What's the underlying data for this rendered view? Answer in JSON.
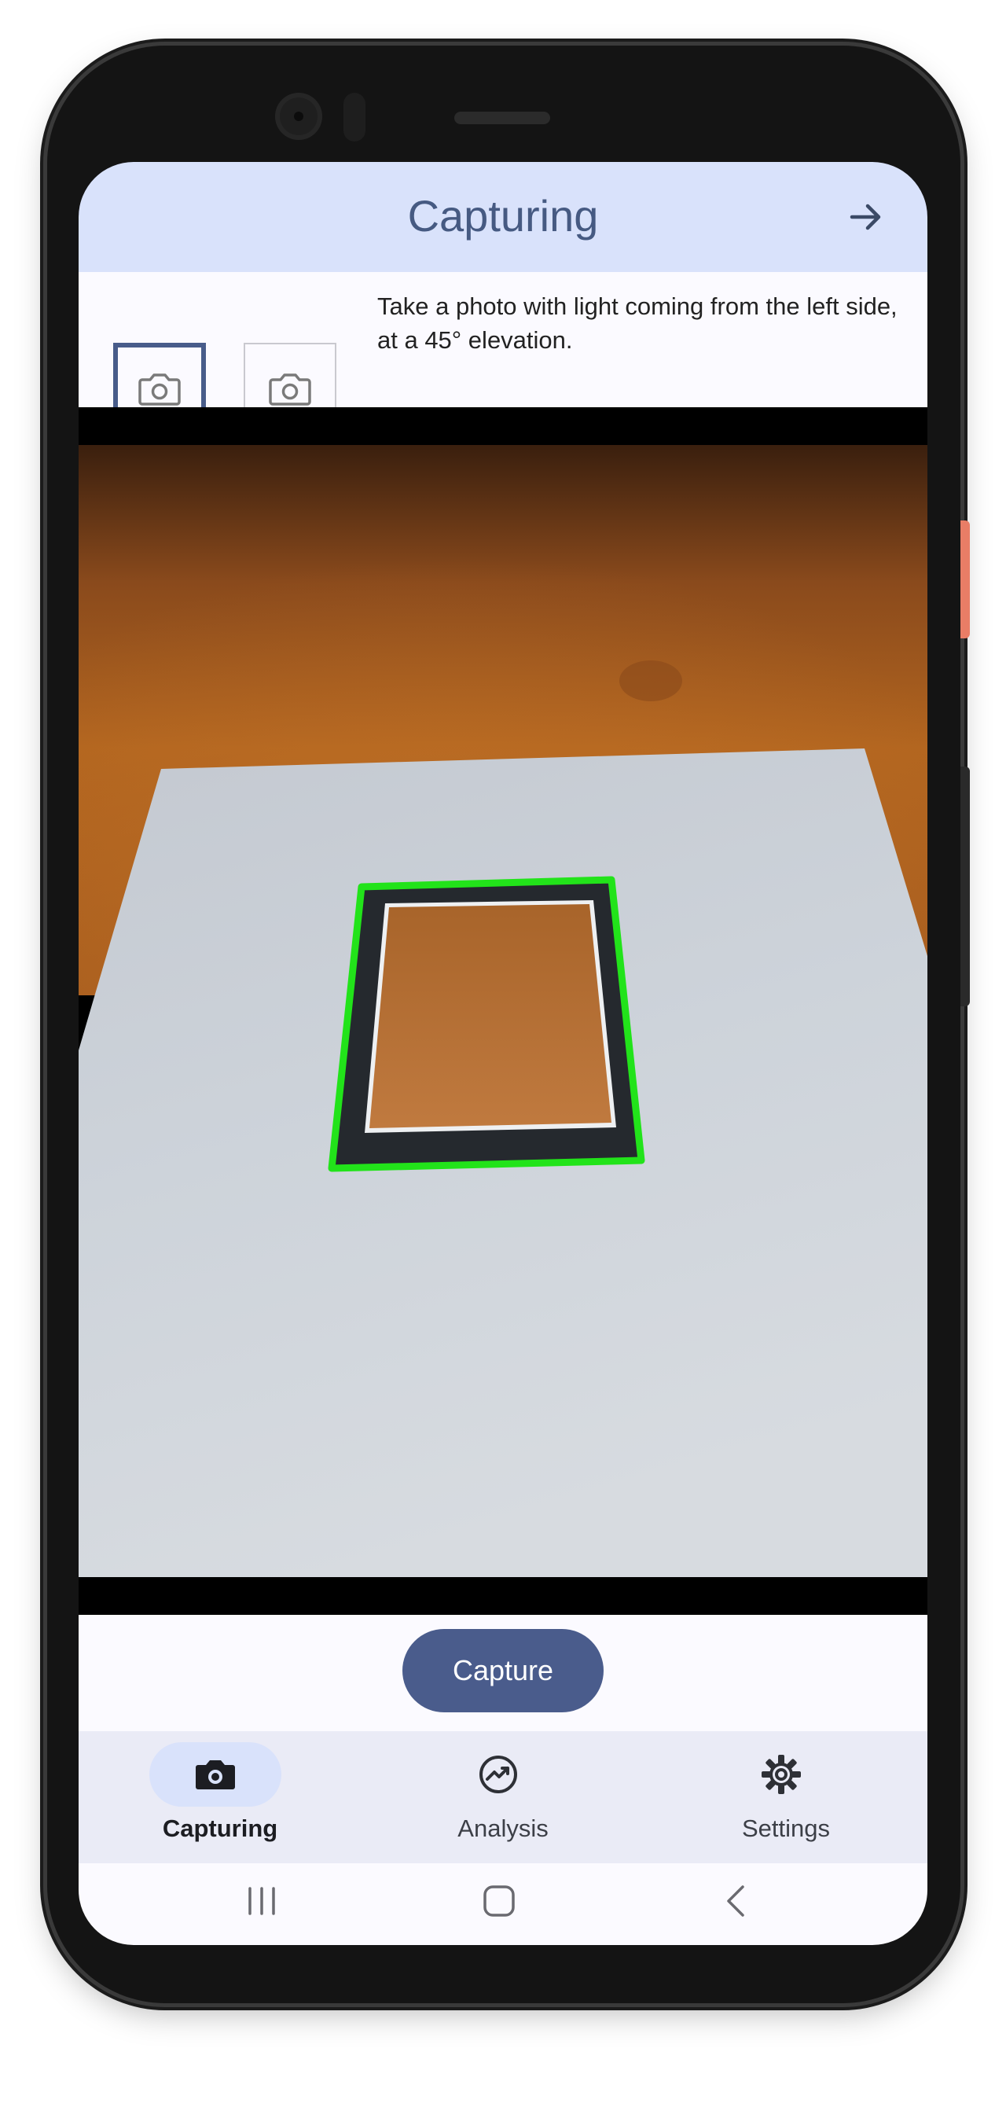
{
  "app": {
    "title": "Capturing"
  },
  "header": {
    "next_icon": "arrow-right-icon"
  },
  "instruction": {
    "text": "Take a photo with light coming from the left side, at a 45° elevation.",
    "slots": [
      {
        "icon": "camera-outline-icon",
        "state": "active"
      },
      {
        "icon": "camera-outline-icon",
        "state": "empty"
      }
    ]
  },
  "preview": {
    "detection_color": "#22e31a"
  },
  "actions": {
    "capture_label": "Capture"
  },
  "nav": {
    "items": [
      {
        "label": "Capturing",
        "icon": "camera-icon",
        "active": true
      },
      {
        "label": "Analysis",
        "icon": "analysis-icon",
        "active": false
      },
      {
        "label": "Settings",
        "icon": "gear-icon",
        "active": false
      }
    ]
  },
  "system_nav": {
    "buttons": [
      "recents-icon",
      "home-icon",
      "back-icon"
    ]
  },
  "colors": {
    "accent": "#4a5c8c",
    "header_bg": "#d9e2fb",
    "title_text": "#465a82"
  }
}
